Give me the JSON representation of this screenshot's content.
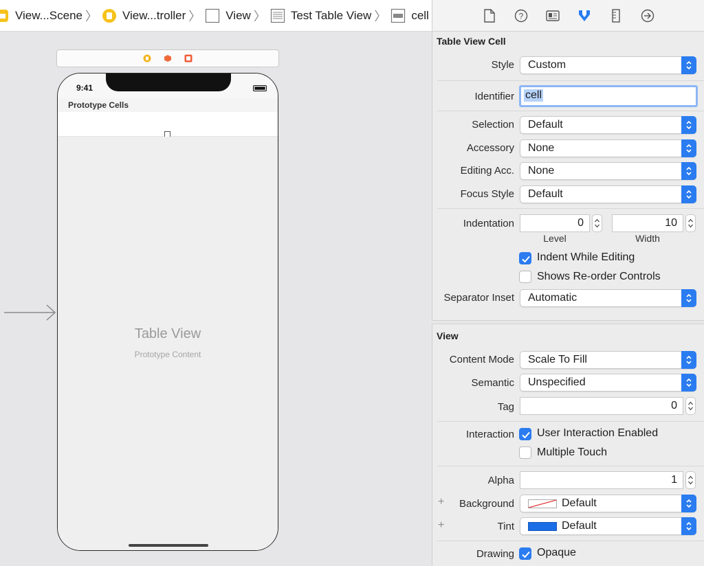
{
  "breadcrumb": {
    "items": [
      {
        "label": "View...Scene",
        "icon": "storyboard-scene-icon"
      },
      {
        "label": "View...troller",
        "icon": "view-controller-icon"
      },
      {
        "label": "View",
        "icon": "view-icon"
      },
      {
        "label": "Test Table View",
        "icon": "table-view-icon"
      },
      {
        "label": "cell",
        "icon": "table-cell-icon"
      }
    ]
  },
  "canvas": {
    "time": "9:41",
    "section_header": "Prototype Cells",
    "table_title": "Table View",
    "table_subtitle": "Prototype Content"
  },
  "inspector": {
    "tabs": [
      "file-inspector-icon",
      "quick-help-icon",
      "identity-inspector-icon",
      "attributes-inspector-icon",
      "size-inspector-icon",
      "connections-inspector-icon"
    ],
    "cell_section": {
      "title": "Table View Cell",
      "style_label": "Style",
      "style_value": "Custom",
      "identifier_label": "Identifier",
      "identifier_value": "cell",
      "selection_label": "Selection",
      "selection_value": "Default",
      "accessory_label": "Accessory",
      "accessory_value": "None",
      "editing_acc_label": "Editing Acc.",
      "editing_acc_value": "None",
      "focus_style_label": "Focus Style",
      "focus_style_value": "Default",
      "indentation_label": "Indentation",
      "level_value": "0",
      "level_label": "Level",
      "width_value": "10",
      "width_label": "Width",
      "indent_while_editing": "Indent While Editing",
      "shows_reorder": "Shows Re-order Controls",
      "separator_inset_label": "Separator Inset",
      "separator_inset_value": "Automatic"
    },
    "view_section": {
      "title": "View",
      "content_mode_label": "Content Mode",
      "content_mode_value": "Scale To Fill",
      "semantic_label": "Semantic",
      "semantic_value": "Unspecified",
      "tag_label": "Tag",
      "tag_value": "0",
      "interaction_label": "Interaction",
      "user_interaction": "User Interaction Enabled",
      "multiple_touch": "Multiple Touch",
      "alpha_label": "Alpha",
      "alpha_value": "1",
      "background_label": "Background",
      "background_value": "Default",
      "tint_label": "Tint",
      "tint_value": "Default",
      "drawing_label": "Drawing",
      "opaque": "Opaque",
      "plus": "+"
    }
  },
  "colors": {
    "accent": "#2a7cf0",
    "tint_swatch": "#1b6fe6"
  }
}
